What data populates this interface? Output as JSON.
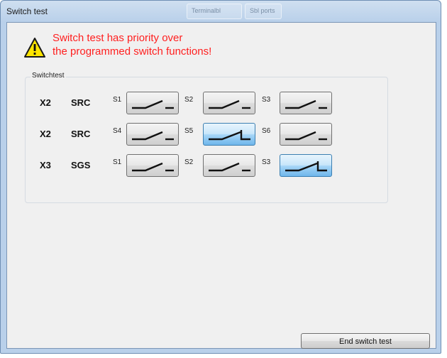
{
  "window": {
    "title": "Switch test"
  },
  "background_tabs": [
    "Terminalbl",
    "Sbl ports"
  ],
  "warning": {
    "line1": "Switch test has priority over",
    "line2": "the programmed switch functions!",
    "color": "#ff1f1f"
  },
  "group": {
    "label": "Switchtest"
  },
  "rows": [
    {
      "connector": "X2",
      "device": "SRC",
      "switches": [
        {
          "label": "S1",
          "state": "open"
        },
        {
          "label": "S2",
          "state": "open"
        },
        {
          "label": "S3",
          "state": "open"
        }
      ]
    },
    {
      "connector": "X2",
      "device": "SRC",
      "switches": [
        {
          "label": "S4",
          "state": "open"
        },
        {
          "label": "S5",
          "state": "closed"
        },
        {
          "label": "S6",
          "state": "open"
        }
      ]
    },
    {
      "connector": "X3",
      "device": "SGS",
      "switches": [
        {
          "label": "S1",
          "state": "open"
        },
        {
          "label": "S2",
          "state": "open"
        },
        {
          "label": "S3",
          "state": "closed"
        }
      ]
    }
  ],
  "footer": {
    "end_label": "End switch test"
  },
  "icons": {
    "warning": "warning-triangle-icon",
    "switch_open": "switch-open-icon",
    "switch_closed": "switch-closed-icon"
  },
  "colors": {
    "active_switch": "#a7d6f7",
    "window_frame": "#b9d0ea"
  }
}
